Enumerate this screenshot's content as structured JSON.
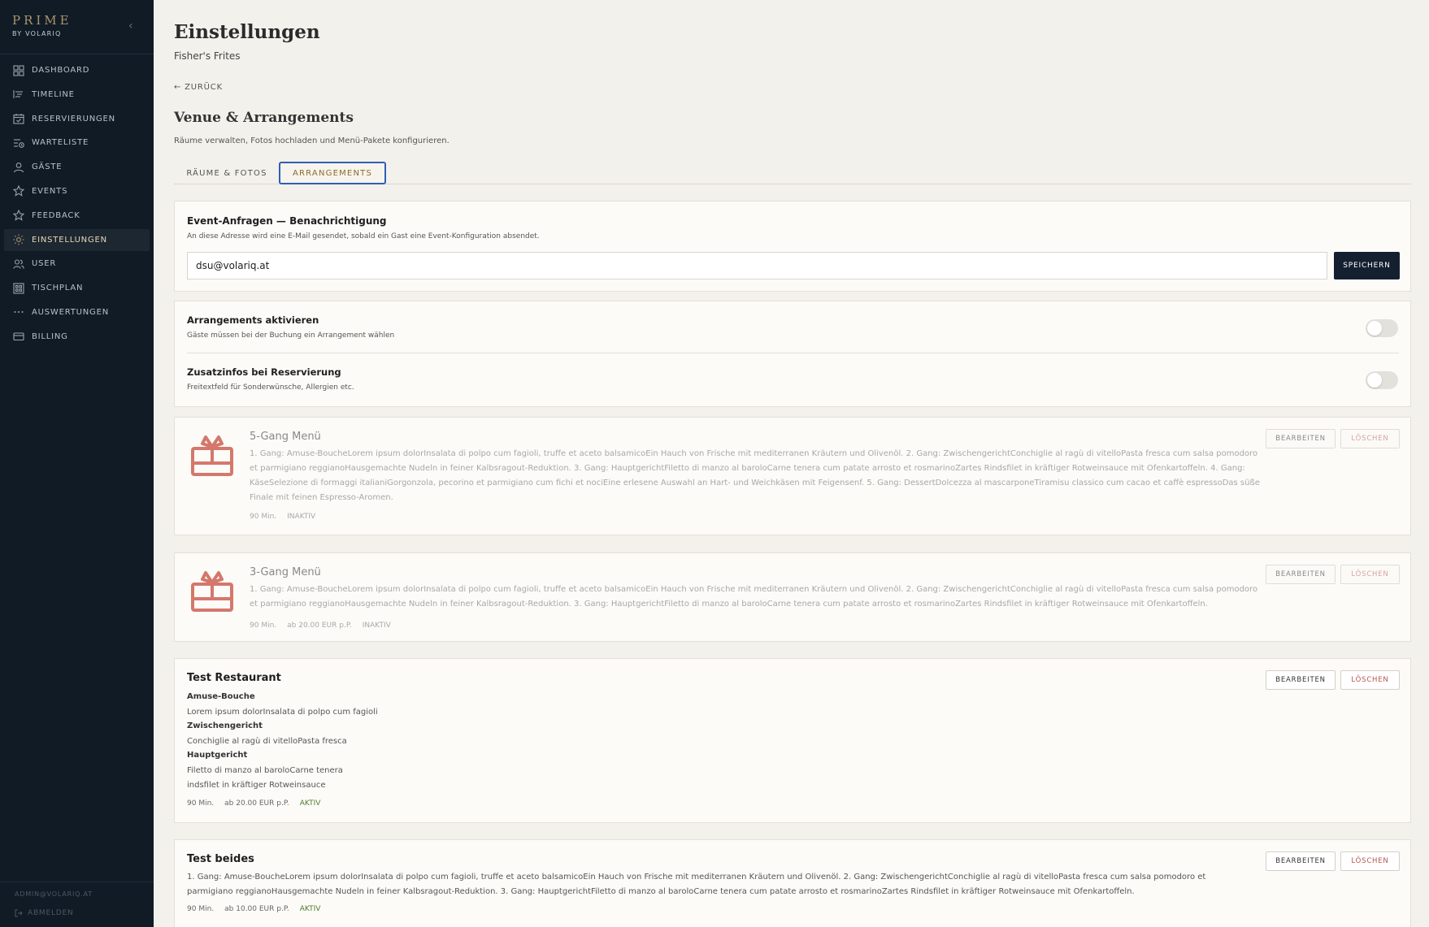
{
  "brand": {
    "title": "PRIME",
    "subtitle": "BY VOLARIQ",
    "collapse_icon": "chevron-left-icon"
  },
  "nav": [
    {
      "label": "DASHBOARD",
      "icon": "grid-icon"
    },
    {
      "label": "TIMELINE",
      "icon": "timeline-icon"
    },
    {
      "label": "RESERVIERUNGEN",
      "icon": "calendar-icon"
    },
    {
      "label": "WARTELISTE",
      "icon": "list-clock-icon"
    },
    {
      "label": "GÄSTE",
      "icon": "person-icon"
    },
    {
      "label": "EVENTS",
      "icon": "star-icon"
    },
    {
      "label": "FEEDBACK",
      "icon": "star-outline-icon"
    },
    {
      "label": "EINSTELLUNGEN",
      "icon": "sun-gear-icon",
      "active": true
    },
    {
      "label": "USER",
      "icon": "users-icon"
    },
    {
      "label": "TISCHPLAN",
      "icon": "floorplan-icon"
    },
    {
      "label": "AUSWERTUNGEN",
      "icon": "dots-icon"
    },
    {
      "label": "BILLING",
      "icon": "card-icon"
    }
  ],
  "sidebar_footer": {
    "email": "ADMIN@VOLARIQ.AT",
    "logout": "ABMELDEN"
  },
  "header": {
    "title": "Einstellungen",
    "venue": "Fisher's Frites",
    "back": "← ZURÜCK"
  },
  "section": {
    "title": "Venue & Arrangements",
    "subtitle": "Räume verwalten, Fotos hochladen und Menü-Pakete konfigurieren."
  },
  "tabs": [
    {
      "label": "RÄUME & FOTOS"
    },
    {
      "label": "ARRANGEMENTS",
      "active": true
    }
  ],
  "notification": {
    "title": "Event-Anfragen — Benachrichtigung",
    "description": "An diese Adresse wird eine E-Mail gesendet, sobald ein Gast eine Event-Konfiguration absendet.",
    "email_value": "dsu@volariq.at",
    "save_label": "SPEICHERN"
  },
  "toggles": [
    {
      "title": "Arrangements aktivieren",
      "description": "Gäste müssen bei der Buchung ein Arrangement wählen",
      "on": false
    },
    {
      "title": "Zusatzinfos bei Reservierung",
      "description": "Freitextfeld für Sonderwünsche, Allergien etc.",
      "on": false
    }
  ],
  "buttons": {
    "edit": "BEARBEITEN",
    "delete": "LÖSCHEN"
  },
  "arrangements": [
    {
      "name": "5-Gang Menü",
      "description": "1. Gang: Amuse-BoucheLorem ipsum dolorInsalata di polpo cum fagioli, truffe et aceto balsamicoEin Hauch von Frische mit mediterranen Kräutern und Olivenöl. 2. Gang: ZwischengerichtConchiglie al ragù di vitelloPasta fresca cum salsa pomodoro et parmigiano reggianoHausgemachte Nudeln in feiner Kalbsragout-Reduktion. 3. Gang: HauptgerichtFiletto di manzo al baroloCarne tenera cum patate arrosto et rosmarinoZartes Rindsfilet in kräftiger Rotweinsauce mit Ofenkartoffeln. 4. Gang: KäseSelezione di formaggi italianiGorgonzola, pecorino et parmigiano cum fichi et nociEine erlesene Auswahl an Hart- und Weichkäsen mit Feigensenf. 5. Gang: DessertDolcezza al mascarponeTiramisu classico cum cacao et caffè espressoDas süße Finale mit feinen Espresso-Aromen.",
      "duration": "90 Min.",
      "status": "INAKTIV"
    },
    {
      "name": "3-Gang Menü",
      "description": "1. Gang: Amuse-BoucheLorem ipsum dolorInsalata di polpo cum fagioli, truffe et aceto balsamicoEin Hauch von Frische mit mediterranen Kräutern und Olivenöl. 2. Gang: ZwischengerichtConchiglie al ragù di vitelloPasta fresca cum salsa pomodoro et parmigiano reggianoHausgemachte Nudeln in feiner Kalbsragout-Reduktion. 3. Gang: HauptgerichtFiletto di manzo al baroloCarne tenera cum patate arrosto et rosmarinoZartes Rindsfilet in kräftiger Rotweinsauce mit Ofenkartoffeln.",
      "duration": "90 Min.",
      "price": "ab 20.00 EUR p.P.",
      "status": "INAKTIV"
    },
    {
      "name": "Test Restaurant",
      "courses": [
        {
          "title": "Amuse-Bouche",
          "lines": [
            "Lorem ipsum dolorInsalata di polpo cum fagioli"
          ]
        },
        {
          "title": "Zwischengericht",
          "lines": [
            "Conchiglie al ragù di vitelloPasta fresca"
          ]
        },
        {
          "title": "Hauptgericht",
          "lines": [
            "Filetto di manzo al baroloCarne tenera",
            "indsfilet in kräftiger Rotweinsauce"
          ]
        }
      ],
      "duration": "90 Min.",
      "price": "ab 20.00 EUR p.P.",
      "status": "AKTIV"
    },
    {
      "name": "Test beides",
      "description": "1. Gang: Amuse-BoucheLorem ipsum dolorInsalata di polpo cum fagioli, truffe et aceto balsamicoEin Hauch von Frische mit mediterranen Kräutern und Olivenöl. 2. Gang: ZwischengerichtConchiglie al ragù di vitelloPasta fresca cum salsa pomodoro et parmigiano reggianoHausgemachte Nudeln in feiner Kalbsragout-Reduktion. 3. Gang: HauptgerichtFiletto di manzo al baroloCarne tenera cum patate arrosto et rosmarinoZartes Rindsfilet in kräftiger Rotweinsauce mit Ofenkartoffeln.",
      "duration": "90 Min.",
      "price": "ab 10.00 EUR p.P.",
      "status": "AKTIV"
    }
  ],
  "colors": {
    "sidebar_bg": "#101b26",
    "accent_gold": "#a9956a",
    "primary_button": "#142030",
    "active_status": "#4e7a2b",
    "delete": "#b5544c",
    "gift_icon": "#d4786c",
    "focus_ring": "#2f5fb5"
  }
}
